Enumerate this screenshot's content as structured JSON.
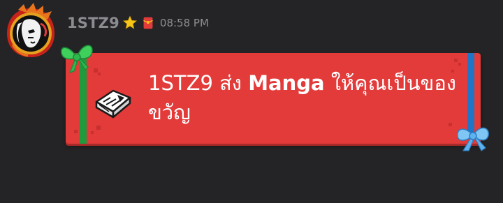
{
  "message": {
    "username": "1STZ9",
    "time": "08:58 PM",
    "badges": [
      "star-badge-icon",
      "red-envelope-icon"
    ],
    "avatar": "avatar-dragon"
  },
  "gift": {
    "sender": "1STZ9",
    "verb": "ส่ง",
    "item": "Manga",
    "rest": "ให้คุณเป็นของขวัญ",
    "icon": "manga-book-icon",
    "colors": {
      "card": "#e23b3a",
      "left_ribbon": "#1f9a3d",
      "right_ribbon": "#1e76c8"
    }
  }
}
